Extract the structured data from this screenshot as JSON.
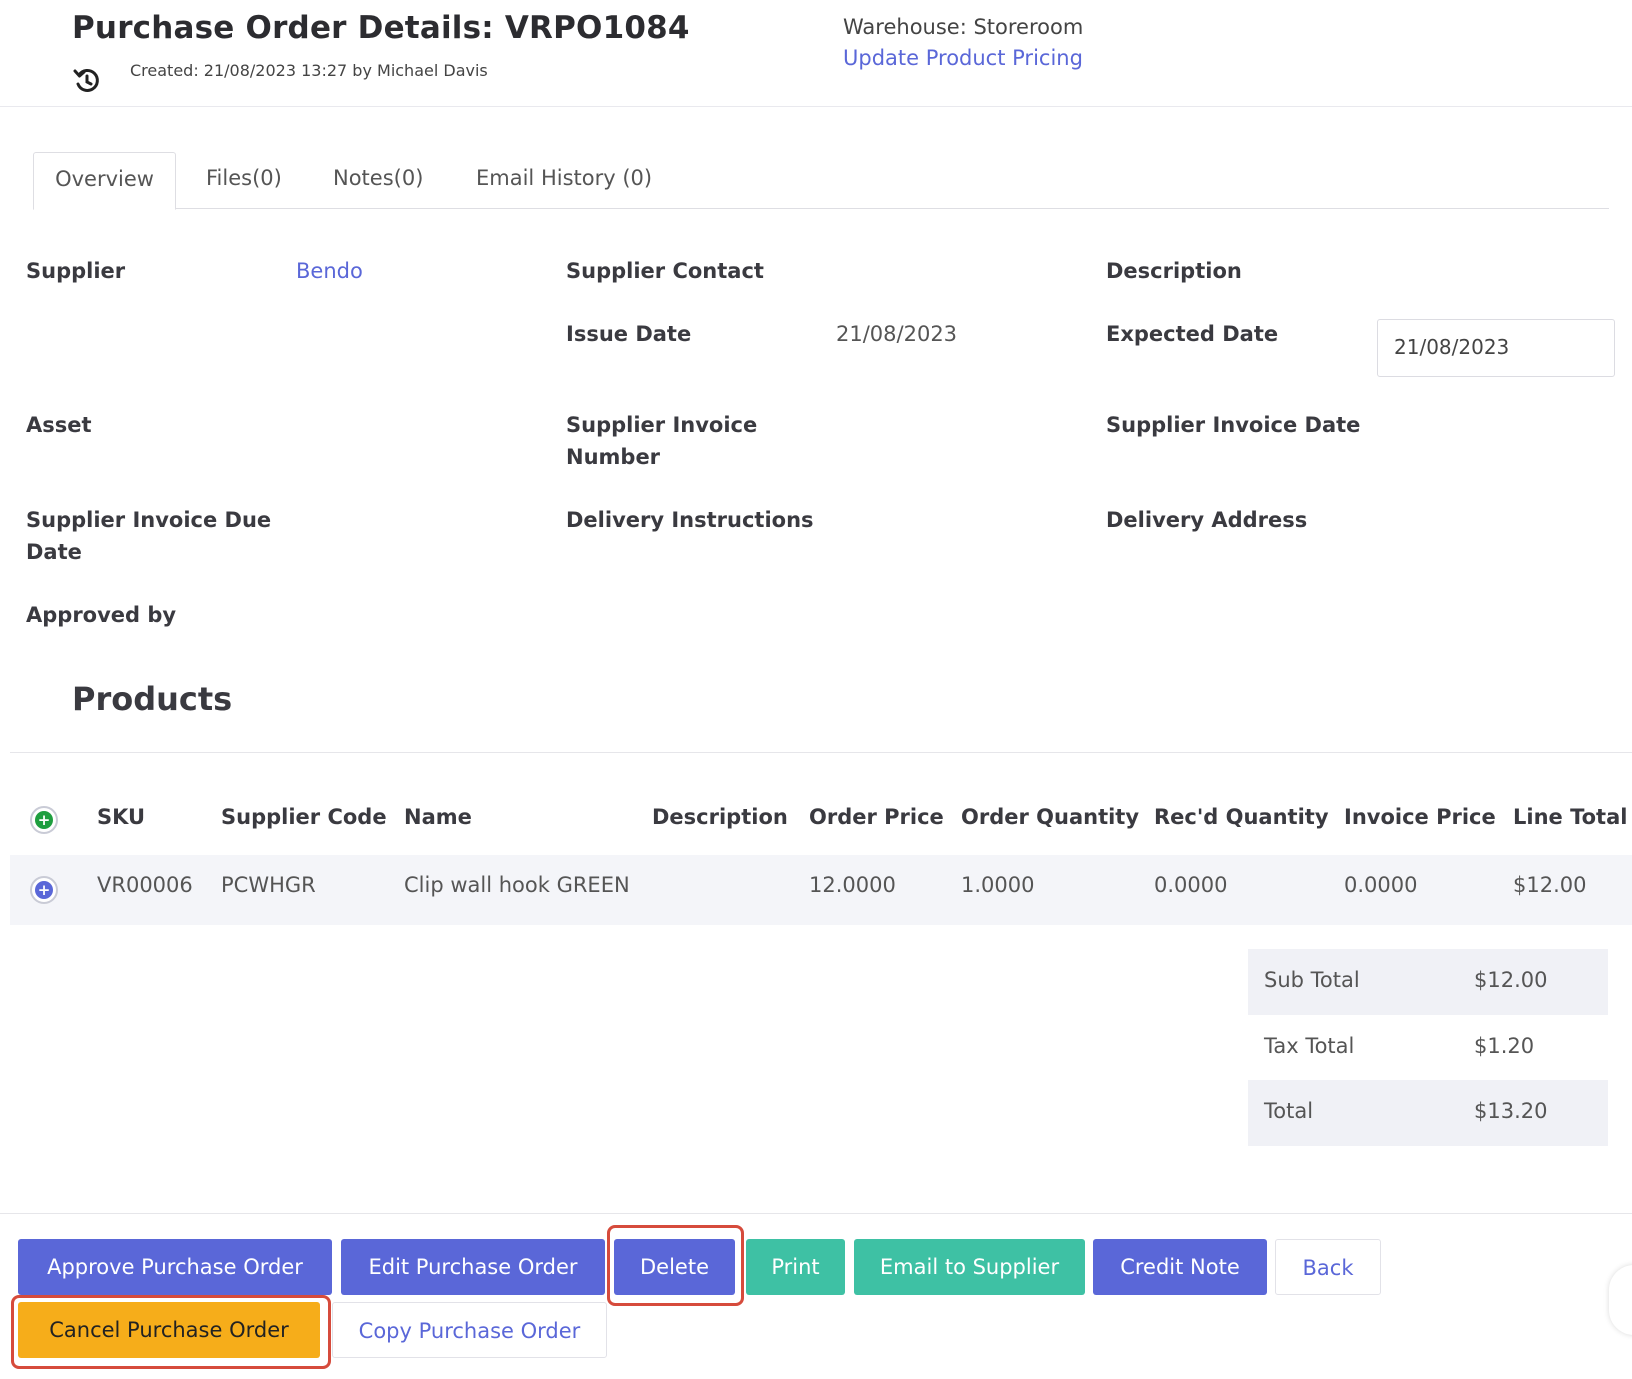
{
  "header": {
    "title": "Purchase Order Details: VRPO1084",
    "created": "Created: 21/08/2023 13:27 by Michael Davis",
    "warehouse": "Warehouse: Storeroom",
    "update_pricing": "Update Product Pricing"
  },
  "tabs": [
    {
      "label": "Overview",
      "active": true
    },
    {
      "label": "Files(0)"
    },
    {
      "label": "Notes(0)"
    },
    {
      "label": "Email History (0)"
    }
  ],
  "fields": {
    "supplier_label": "Supplier",
    "supplier_value": "Bendo",
    "supplier_contact_label": "Supplier Contact",
    "description_label": "Description",
    "issue_date_label": "Issue Date",
    "issue_date_value": "21/08/2023",
    "expected_date_label": "Expected Date",
    "expected_date_value": "21/08/2023",
    "asset_label": "Asset",
    "supplier_invoice_number_label_1": "Supplier Invoice",
    "supplier_invoice_number_label_2": "Number",
    "supplier_invoice_date_label": "Supplier Invoice Date",
    "supplier_invoice_due_label_1": "Supplier Invoice Due",
    "supplier_invoice_due_label_2": "Date",
    "delivery_instructions_label": "Delivery Instructions",
    "delivery_address_label": "Delivery Address",
    "approved_by_label": "Approved by"
  },
  "products": {
    "title": "Products",
    "columns": [
      "SKU",
      "Supplier Code",
      "Name",
      "Description",
      "Order Price",
      "Order Quantity",
      "Rec'd Quantity",
      "Invoice Price",
      "Line Total"
    ],
    "rows": [
      {
        "sku": "VR00006",
        "supplier_code": "PCWHGR",
        "name": "Clip wall hook GREEN",
        "description": "",
        "order_price": "12.0000",
        "order_quantity": "1.0000",
        "recd_quantity": "0.0000",
        "invoice_price": "0.0000",
        "line_total": "$12.00"
      }
    ]
  },
  "totals": {
    "sub_total_label": "Sub Total",
    "sub_total_value": "$12.00",
    "tax_total_label": "Tax Total",
    "tax_total_value": "$1.20",
    "total_label": "Total",
    "total_value": "$13.20"
  },
  "actions": {
    "approve": "Approve Purchase Order",
    "edit": "Edit Purchase Order",
    "delete": "Delete",
    "print": "Print",
    "email_supplier": "Email to Supplier",
    "credit_note": "Credit Note",
    "back": "Back",
    "cancel": "Cancel Purchase Order",
    "copy": "Copy Purchase Order"
  },
  "icons": {
    "add_row": "plus-circle-green-icon",
    "expand_row": "plus-circle-blue-icon",
    "history": "history-icon"
  },
  "colors": {
    "primary": "#5a67d8",
    "teal": "#3ec1a4",
    "orange": "#f6ad1a",
    "highlight": "#d64b3c",
    "add_green": "#1e9e3f"
  }
}
